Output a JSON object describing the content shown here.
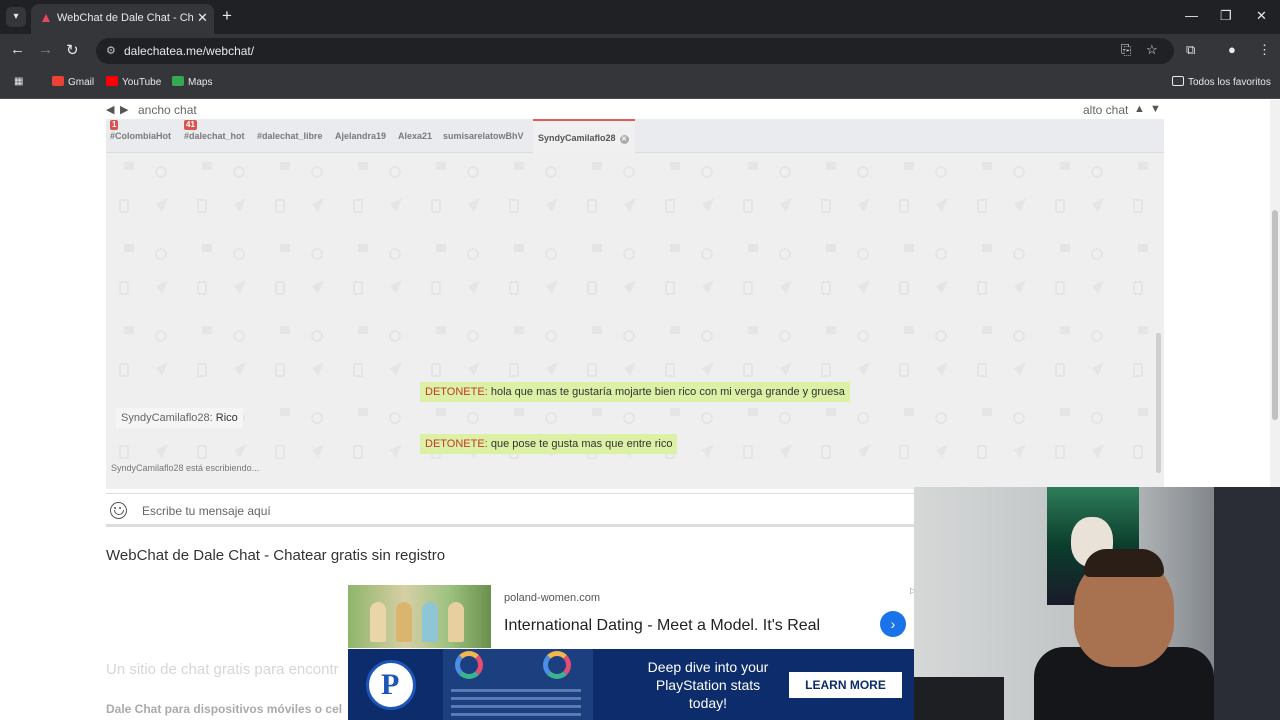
{
  "browser": {
    "tab_title": "WebChat de Dale Chat - Chatear gratis sin registro",
    "url": "dalechatea.me/webchat/",
    "bookmarks": [
      {
        "label": "Gmail",
        "icon": "gmail-icon",
        "color": "#ea4335"
      },
      {
        "label": "YouTube",
        "icon": "youtube-icon",
        "color": "#ff0000"
      },
      {
        "label": "Maps",
        "icon": "maps-icon",
        "color": "#34a853"
      }
    ],
    "all_bookmarks": "Todos los favoritos"
  },
  "chat": {
    "width_label": "ancho chat",
    "height_label": "alto chat",
    "tabs": [
      {
        "label": "#ColombiaHot",
        "badge": "1"
      },
      {
        "label": "#dalechat_hot",
        "badge": "41"
      },
      {
        "label": "#dalechat_libre",
        "badge": ""
      },
      {
        "label": "Ajelandra19",
        "badge": ""
      },
      {
        "label": "Alexa21",
        "badge": ""
      },
      {
        "label": "sumisarelatowBhV",
        "badge": ""
      },
      {
        "label": "SyndyCamilaflo28",
        "badge": "",
        "active": true
      }
    ],
    "messages": [
      {
        "nick": "DETONETE:",
        "text": "hola que mas te gustaría mojarte bien rico con mi verga grande y gruesa",
        "side": "out"
      },
      {
        "nick": "SyndyCamilaflo28:",
        "text": "Rico",
        "side": "in"
      },
      {
        "nick": "DETONETE:",
        "text": "que pose te gusta mas que entre rico",
        "side": "out"
      }
    ],
    "typing": "SyndyCamilaflo28 está escribiendo...",
    "input_placeholder": "Escribe tu mensaje aquí"
  },
  "page": {
    "heading": "WebChat de Dale Chat - Chatear gratis sin registro",
    "faded_line": "Un sitio de chat gratis para encontr",
    "faded_bold": "Dale Chat para dispositivos móviles o cel"
  },
  "ads": {
    "ad1_domain": "poland-women.com",
    "ad1_title": "International Dating - Meet a Model. It's Real",
    "ad2_text": "Deep dive into your PlayStation stats today!",
    "ad2_button": "LEARN MORE",
    "ad2_logo": "P"
  },
  "colors": {
    "accent_tab": "#e35b5b",
    "outgoing_bubble": "#dcf0a6",
    "nick_color": "#c0392b"
  }
}
